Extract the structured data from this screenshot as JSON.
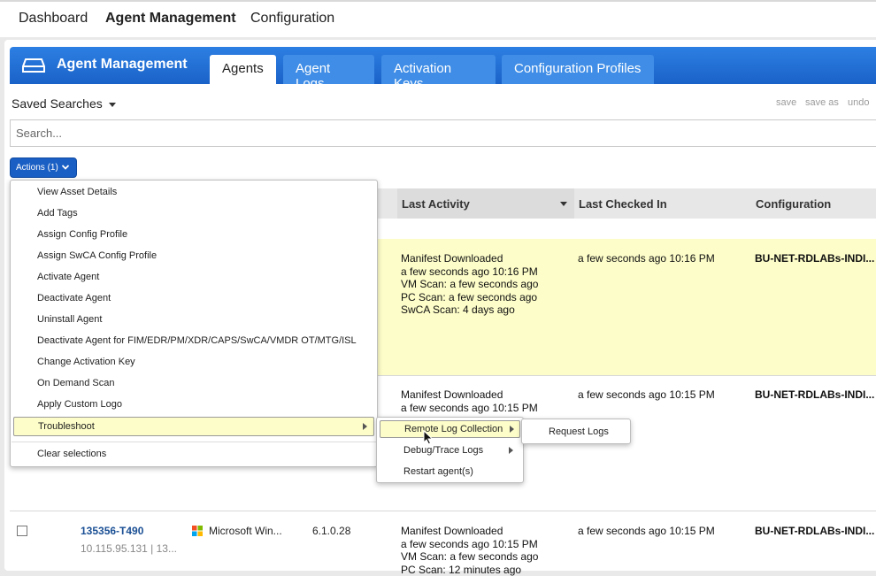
{
  "topnav": {
    "items": [
      {
        "label": "Dashboard",
        "active": false
      },
      {
        "label": "Agent Management",
        "active": true
      },
      {
        "label": "Configuration",
        "active": false
      }
    ]
  },
  "module": {
    "title": "Agent Management",
    "icon": "drive-icon",
    "tabs": [
      {
        "label": "Agents",
        "active": true
      },
      {
        "label": "Agent Logs",
        "active": false
      },
      {
        "label": "Activation Keys",
        "active": false
      },
      {
        "label": "Configuration Profiles",
        "active": false
      }
    ]
  },
  "search": {
    "saved_searches_label": "Saved Searches",
    "save": "save",
    "save_as": "save as",
    "undo": "undo",
    "placeholder": "Search..."
  },
  "actions": {
    "label": "Actions (1)"
  },
  "table": {
    "columns": [
      "Last Activity",
      "Last Checked In",
      "Configuration"
    ],
    "rows": [
      {
        "highlighted": true,
        "last_activity": [
          "Manifest Downloaded",
          "a few seconds ago 10:16 PM",
          "VM Scan: a few seconds ago",
          "PC Scan: a few seconds ago",
          "SwCA Scan: 4 days ago"
        ],
        "last_checked_in": "a few seconds ago 10:16 PM",
        "configuration": "BU-NET-RDLABs-INDI..."
      },
      {
        "highlighted": false,
        "last_activity": [
          "Manifest Downloaded",
          "a few seconds ago 10:15 PM"
        ],
        "last_checked_in": "a few seconds ago 10:15 PM",
        "configuration": "BU-NET-RDLABs-INDI..."
      },
      {
        "highlighted": false,
        "agent_name": "135356-T490",
        "ip": "10.115.95.131 | 13...",
        "os": "Microsoft Win...",
        "version": "6.1.0.28",
        "last_activity": [
          "Manifest Downloaded",
          "a few seconds ago 10:15 PM",
          "VM Scan: a few seconds ago",
          "PC Scan: 12 minutes ago"
        ],
        "last_checked_in": "a few seconds ago 10:15 PM",
        "configuration": "BU-NET-RDLABs-INDI..."
      }
    ]
  },
  "actions_menu": {
    "items": [
      "View Asset Details",
      "Add Tags",
      "Assign Config Profile",
      "Assign SwCA Config Profile",
      "Activate Agent",
      "Deactivate Agent",
      "Uninstall Agent",
      "Deactivate Agent for FIM/EDR/PM/XDR/CAPS/SwCA/VMDR OT/MTG/ISL",
      "Change Activation Key",
      "On Demand Scan",
      "Apply Custom Logo",
      "Troubleshoot",
      "Clear selections"
    ]
  },
  "troubleshoot_menu": {
    "items": [
      "Remote Log Collection",
      "Debug/Trace Logs",
      "Restart agent(s)"
    ]
  },
  "remote_log_menu": {
    "items": [
      "Request Logs"
    ]
  },
  "colors": {
    "header_blue": "#1a62c8",
    "tab_blue": "#3f8de6",
    "row_highlight": "#fdfdc9",
    "link": "#1a4f94"
  }
}
